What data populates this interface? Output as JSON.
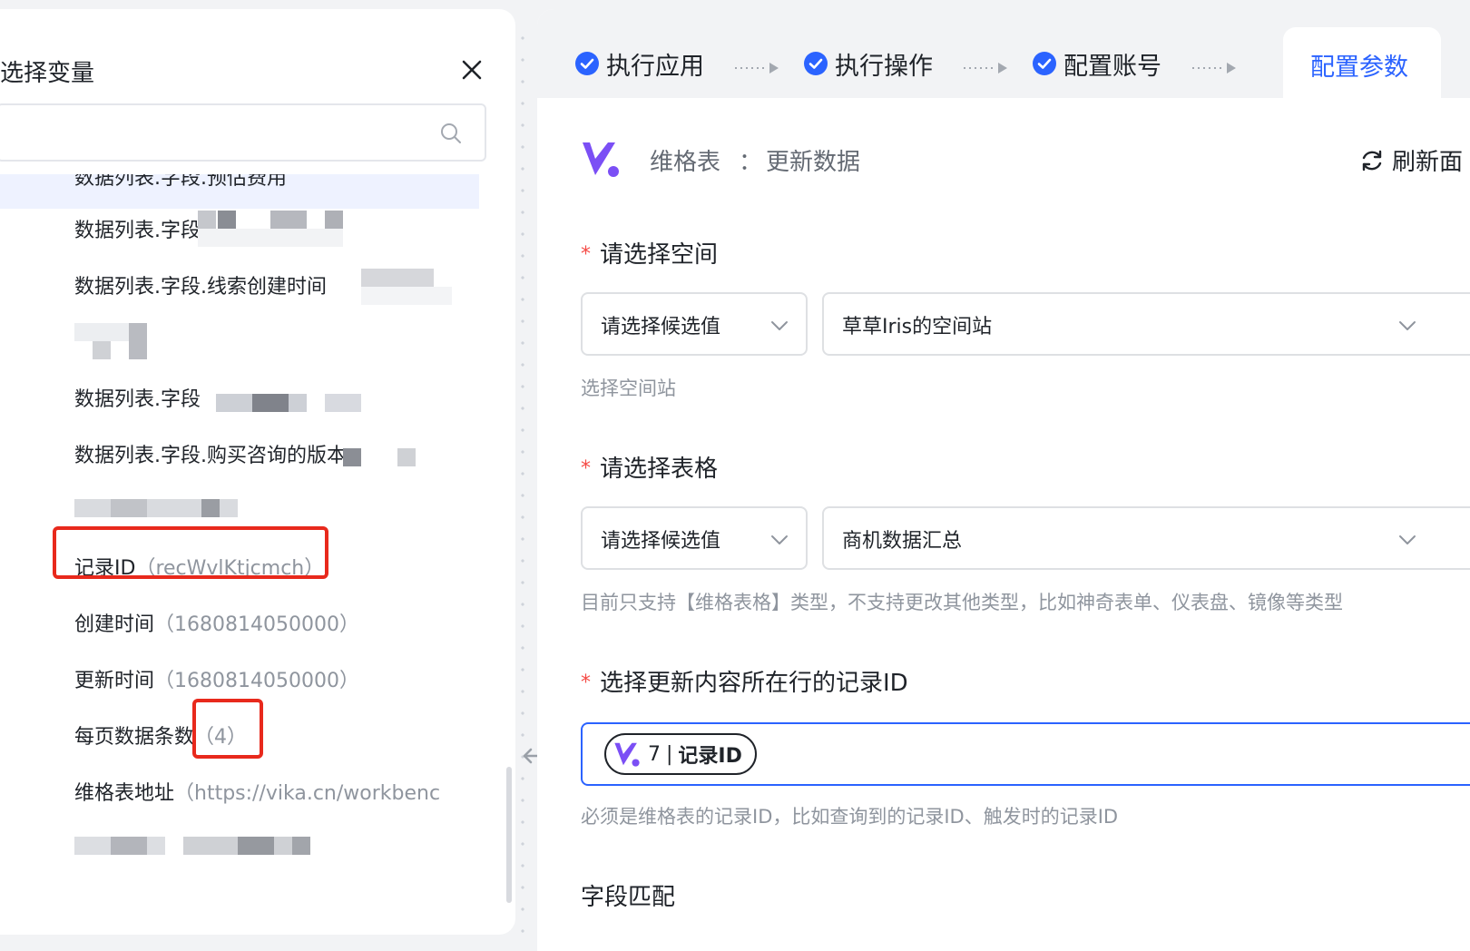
{
  "variable_panel": {
    "title": "选择变量",
    "search": {
      "placeholder": "",
      "value": ""
    },
    "items": [
      {
        "label": "数据列表.字段.预估费用",
        "value": ""
      },
      {
        "label": "数据列表.字段",
        "value": ""
      },
      {
        "label": "数据列表.字段.线索创建时间",
        "value": ""
      },
      {
        "label": "数据列表.字段",
        "value": ""
      },
      {
        "label": "数据列表.字段.购买咨询的版本",
        "value": ""
      },
      {
        "label": "记录ID",
        "value": "（recWvlKtjcmch）"
      },
      {
        "label": "创建时间",
        "value": "（1680814050000）"
      },
      {
        "label": "更新时间",
        "value": "（1680814050000）"
      },
      {
        "label": "每页数据条数",
        "value": "（4）"
      },
      {
        "label": "维格表地址",
        "value": "（https://vika.cn/workbenc"
      }
    ]
  },
  "steps": [
    {
      "label": "执行应用",
      "status": "done"
    },
    {
      "label": "执行操作",
      "status": "done"
    },
    {
      "label": "配置账号",
      "status": "done"
    },
    {
      "label": "配置参数",
      "status": "active"
    }
  ],
  "app": {
    "name": "维格表",
    "separator": "：",
    "action": "更新数据",
    "refresh_label": "刷新面"
  },
  "form": {
    "space": {
      "label": "请选择空间",
      "mode_value": "请选择候选值",
      "value": "草草Iris的空间站",
      "hint": "选择空间站"
    },
    "table": {
      "label": "请选择表格",
      "mode_value": "请选择候选值",
      "value": "商机数据汇总",
      "hint": "目前只支持【维格表格】类型，不支持更改其他类型，比如神奇表单、仪表盘、镜像等类型"
    },
    "record": {
      "label": "选择更新内容所在行的记录ID",
      "token": {
        "step": "7",
        "separator": "|",
        "label": "记录ID"
      },
      "hint": "必须是维格表的记录ID，比如查询到的记录ID、触发时的记录ID"
    },
    "field_match": {
      "label": "字段匹配"
    }
  },
  "colors": {
    "accent": "#2b63ff",
    "required": "#f54a45",
    "highlight": "#e8291c",
    "logo": "#7b4ff5"
  }
}
